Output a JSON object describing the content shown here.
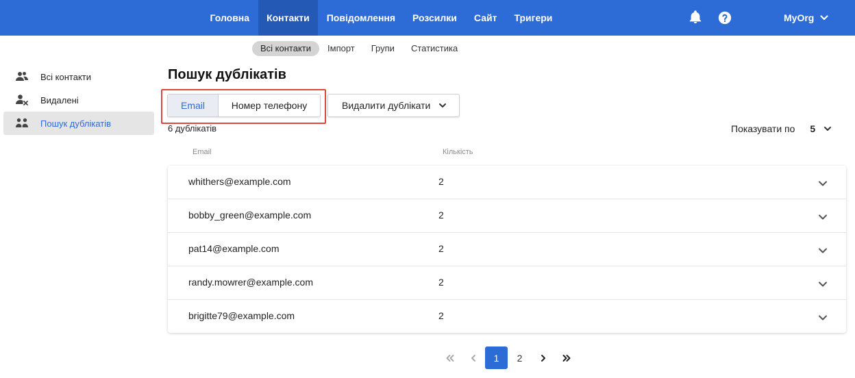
{
  "topnav": {
    "items": [
      {
        "label": "Головна"
      },
      {
        "label": "Контакти",
        "active": true
      },
      {
        "label": "Повідомлення"
      },
      {
        "label": "Розсилки"
      },
      {
        "label": "Сайт"
      },
      {
        "label": "Тригери"
      }
    ],
    "org_name": "MyOrg",
    "icons": [
      "bell-icon",
      "help-icon",
      "chevron-down-icon"
    ]
  },
  "subnav": {
    "items": [
      {
        "label": "Всі контакти",
        "active": true
      },
      {
        "label": "Імпорт"
      },
      {
        "label": "Групи"
      },
      {
        "label": "Статистика"
      }
    ]
  },
  "sidebar": {
    "items": [
      {
        "label": "Всі контакти",
        "icon": "users-icon"
      },
      {
        "label": "Видалені",
        "icon": "user-remove-icon"
      },
      {
        "label": "Пошук дублікатів",
        "icon": "duplicate-users-icon",
        "active": true
      }
    ]
  },
  "main": {
    "title": "Пошук дублікатів",
    "segmented": {
      "email": "Email",
      "phone": "Номер телефону",
      "selected": "email"
    },
    "delete_button": "Видалити дублікати",
    "dup_count": "6 дублікатів",
    "page_size_label": "Показувати по",
    "page_size_value": "5",
    "columns": {
      "email": "Email",
      "count": "Кількість"
    },
    "rows": [
      {
        "email": "whithers@example.com",
        "count": "2"
      },
      {
        "email": "bobby_green@example.com",
        "count": "2"
      },
      {
        "email": "pat14@example.com",
        "count": "2"
      },
      {
        "email": "randy.mowrer@example.com",
        "count": "2"
      },
      {
        "email": "brigitte79@example.com",
        "count": "2"
      }
    ],
    "pagination": {
      "pages": [
        "1",
        "2"
      ],
      "current": "1",
      "icons": [
        "first-page-icon",
        "prev-page-icon",
        "next-page-icon",
        "last-page-icon"
      ]
    }
  },
  "colors": {
    "primary": "#2d6bd6",
    "topbar_active": "#2459b5",
    "highlight": "#e0443e"
  }
}
